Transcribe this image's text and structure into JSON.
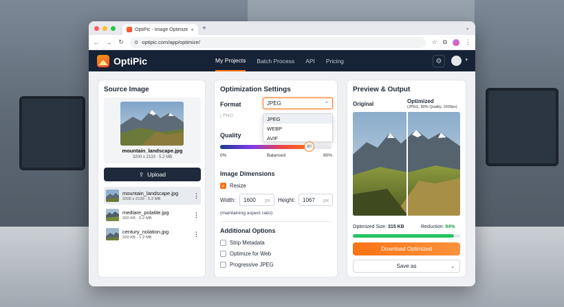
{
  "colors": {
    "accent": "#f97316",
    "nav_bg": "#162235",
    "success": "#22c55e"
  },
  "tab": {
    "title": "OptiPic - Image Optimizer",
    "close": "×",
    "new": "+"
  },
  "address": {
    "url": "optipic.com/app/optimize/"
  },
  "icons": {
    "back": "back-arrow-icon",
    "forward": "forward-arrow-icon",
    "reload": "reload-icon",
    "site_info": "site-info-icon",
    "star": "star-icon",
    "extensions": "extensions-icon",
    "menu": "kebab-menu-icon",
    "settings": "gear-icon",
    "upload": "upload-icon"
  },
  "app": {
    "brand": "OptiPic",
    "nav": [
      "My Projects",
      "Batch Process",
      "API",
      "Pricing"
    ],
    "active_nav": 0
  },
  "source": {
    "title": "Source Image",
    "current": {
      "name": "mountain_landscape.jpg",
      "meta": "3200 x 2133 · 5.2 MB"
    },
    "upload_label": "Upload",
    "files": [
      {
        "name": "mountain_landscape.jpg",
        "meta": "3200 x 2133 · 5.2 MB",
        "selected": true
      },
      {
        "name": "mediare_polatite.jpg",
        "meta": "320 KB · 5.2 MB",
        "selected": false
      },
      {
        "name": "century_nolation.jpg",
        "meta": "320 KB · 1.2 MB",
        "selected": false
      }
    ]
  },
  "settings": {
    "title": "Optimization Settings",
    "format_label": "Format",
    "format_value": "JPEG",
    "format_hint": "( PNG",
    "format_options": [
      "JPEG",
      "WEBP",
      "AVIF"
    ],
    "quality_label": "Quality",
    "quality_value": 80,
    "quality_min_label": "0%",
    "quality_mid_label": "Balanced",
    "quality_max_label": "80%",
    "dimensions_label": "Image Dimensions",
    "resize_label": "Resize",
    "resize_checked": true,
    "width_label": "Width:",
    "width_value": "1600",
    "height_label": "Height:",
    "height_value": "1067",
    "unit": "px",
    "aspect_note": "(maintaining aspect ratio)",
    "additional_label": "Additional Options",
    "options": [
      {
        "label": "Strip Metadata",
        "checked": false
      },
      {
        "label": "Optimize for Web",
        "checked": false
      },
      {
        "label": "Progressive JPEG",
        "checked": false
      }
    ]
  },
  "preview": {
    "title": "Preview & Output",
    "original_label": "Original",
    "optimized_label": "Optimized",
    "optimized_sub": "(JPEG, 80% Quality, 1600px)",
    "size_label": "Optimized Size:",
    "size_value": "315 KB",
    "reduction_label": "Reduction:",
    "reduction_value": "94%",
    "reduction_fraction": 0.94,
    "download_label": "Download Optimized",
    "saveas_label": "Save as"
  }
}
